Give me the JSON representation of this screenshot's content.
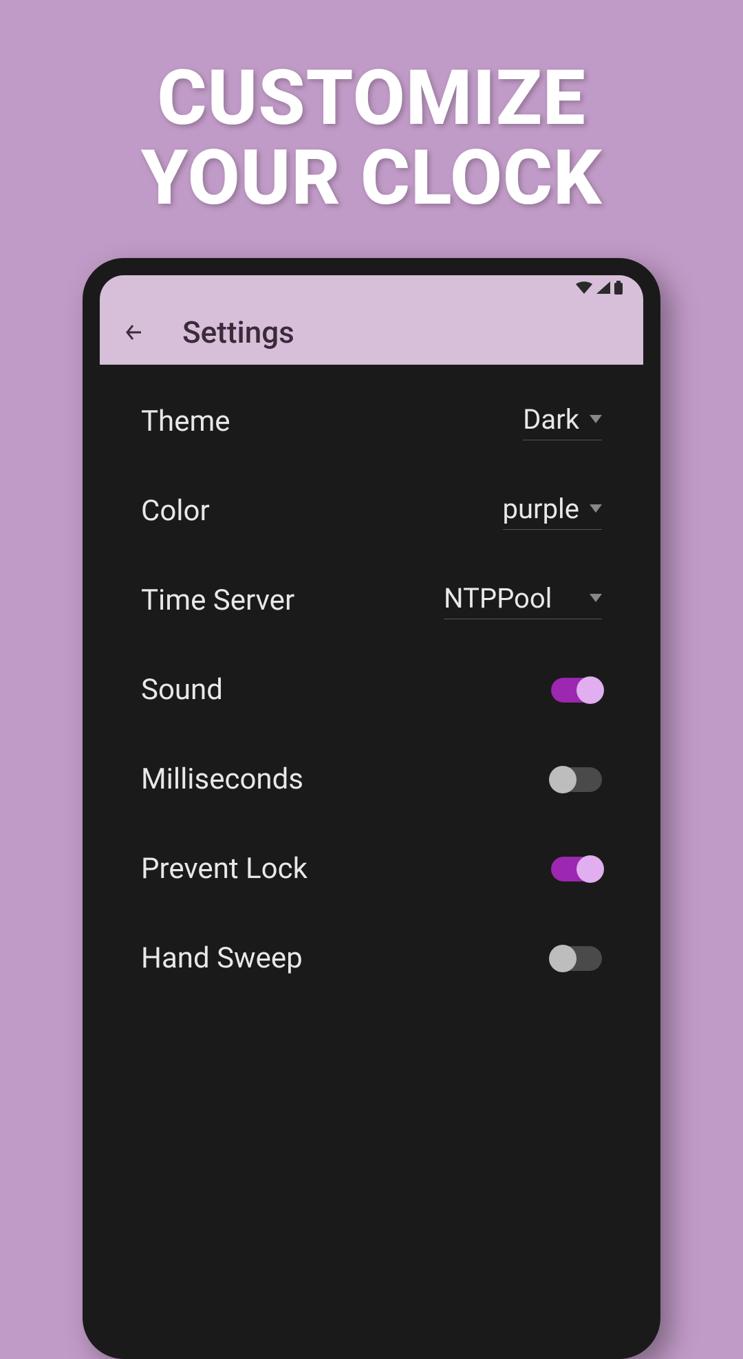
{
  "hero": {
    "line1": "CUSTOMIZE",
    "line2": "YOUR CLOCK"
  },
  "appBar": {
    "title": "Settings"
  },
  "settings": {
    "theme": {
      "label": "Theme",
      "value": "Dark"
    },
    "color": {
      "label": "Color",
      "value": "purple"
    },
    "timeServer": {
      "label": "Time Server",
      "value": "NTPPool"
    },
    "sound": {
      "label": "Sound",
      "on": true
    },
    "milliseconds": {
      "label": "Milliseconds",
      "on": false
    },
    "preventLock": {
      "label": "Prevent Lock",
      "on": true
    },
    "handSweep": {
      "label": "Hand Sweep",
      "on": false
    }
  }
}
